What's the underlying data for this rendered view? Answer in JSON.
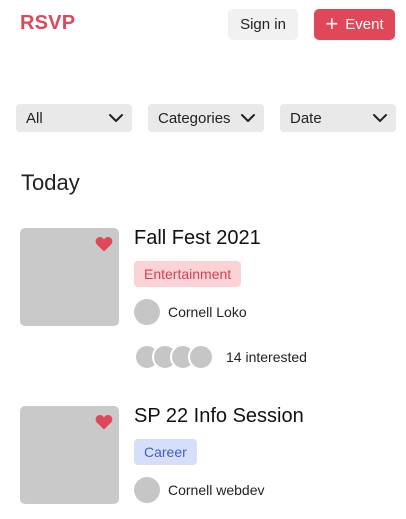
{
  "header": {
    "logo": "RSVP",
    "signin_label": "Sign in",
    "event_label": "Event",
    "accent_color": "#e0485a"
  },
  "filters": [
    {
      "label": "All"
    },
    {
      "label": "Categories"
    },
    {
      "label": "Date"
    }
  ],
  "section_title": "Today",
  "events": [
    {
      "title": "Fall Fest 2021",
      "tag": "Entertainment",
      "organizer": "Cornell Loko",
      "interested_text": "14 interested"
    },
    {
      "title": "SP 22 Info Session",
      "tag": "Career",
      "organizer": "Cornell webdev"
    }
  ],
  "icons": {
    "add": "plus-icon",
    "dropdown": "chevron-down-icon",
    "favorite": "heart-icon"
  }
}
